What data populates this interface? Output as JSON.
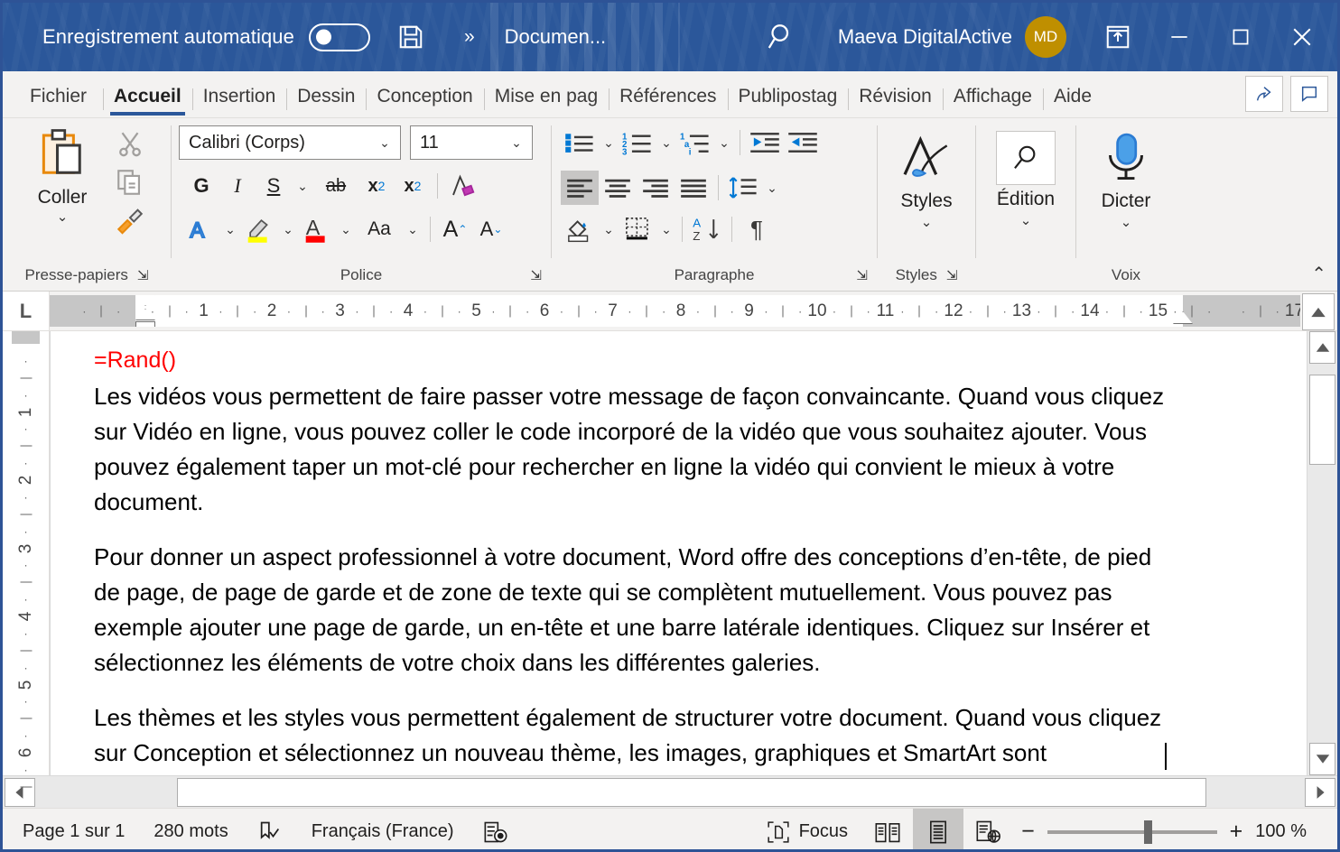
{
  "titlebar": {
    "autosave_label": "Enregistrement automatique",
    "autosave_state": "off",
    "save_icon": "save-icon",
    "more_icon": "chevron-double-right-icon",
    "document_name": "Documen...",
    "search_icon": "search-icon",
    "user_name": "Maeva DigitalActive",
    "avatar_initials": "MD",
    "avatar_color": "#bf8f00",
    "ribbon_display_icon": "ribbon-display-options-icon",
    "minimize_icon": "minimize-icon",
    "maximize_icon": "maximize-icon",
    "close_icon": "close-icon",
    "background_color": "#2b579a"
  },
  "tabs": [
    {
      "label": "Fichier",
      "active": false
    },
    {
      "label": "Accueil",
      "active": true
    },
    {
      "label": "Insertion",
      "active": false
    },
    {
      "label": "Dessin",
      "active": false
    },
    {
      "label": "Conception",
      "active": false
    },
    {
      "label": "Mise en pag",
      "active": false
    },
    {
      "label": "Références",
      "active": false
    },
    {
      "label": "Publipostag",
      "active": false
    },
    {
      "label": "Révision",
      "active": false
    },
    {
      "label": "Affichage",
      "active": false
    },
    {
      "label": "Aide",
      "active": false
    }
  ],
  "tabbar_right": {
    "share_icon": "share-icon",
    "comments_icon": "comment-icon"
  },
  "ribbon": {
    "clipboard": {
      "group_label": "Presse-papiers",
      "paste_label": "Coller",
      "paste_icon": "clipboard-paste-icon",
      "cut_icon": "scissors-icon",
      "copy_icon": "copy-icon",
      "format_painter_icon": "format-painter-icon",
      "launcher_icon": "dialog-launcher-icon"
    },
    "font": {
      "group_label": "Police",
      "family_value": "Calibri (Corps)",
      "size_value": "11",
      "bold_label": "G",
      "italic_label": "I",
      "underline_label": "S",
      "strikethrough_label": "ab",
      "subscript_label": "x",
      "subscript_sub": "2",
      "superscript_label": "x",
      "superscript_sup": "2",
      "clear_format_icon": "clear-formatting-icon",
      "text_effects_icon": "text-effects-icon",
      "highlight_icon": "text-highlight-icon",
      "font_color_icon": "font-color-icon",
      "change_case_label": "Aa",
      "grow_font_label": "A",
      "shrink_font_label": "A",
      "launcher_icon": "dialog-launcher-icon",
      "highlight_color": "#ffff00",
      "font_color": "#ff0000"
    },
    "paragraph": {
      "group_label": "Paragraphe",
      "bullets_icon": "bullet-list-icon",
      "numbering_icon": "numbered-list-icon",
      "multilevel_icon": "multilevel-list-icon",
      "decrease_indent_icon": "decrease-indent-icon",
      "increase_indent_icon": "increase-indent-icon",
      "align_left_icon": "align-left-icon",
      "align_center_icon": "align-center-icon",
      "align_right_icon": "align-right-icon",
      "justify_icon": "justify-icon",
      "line_spacing_icon": "line-spacing-icon",
      "shading_icon": "shading-icon",
      "borders_icon": "borders-icon",
      "sort_icon": "sort-az-icon",
      "show_marks_label": "¶",
      "launcher_icon": "dialog-launcher-icon"
    },
    "styles": {
      "group_label": "Styles",
      "button_label": "Styles",
      "icon": "styles-brush-icon",
      "launcher_icon": "dialog-launcher-icon"
    },
    "editing": {
      "button_label": "Édition",
      "icon": "search-icon"
    },
    "voice": {
      "group_label": "Voix",
      "button_label": "Dicter",
      "icon": "microphone-icon"
    },
    "collapse_icon": "collapse-ribbon-icon"
  },
  "ruler": {
    "tab_stop_label": "L",
    "horizontal_ticks": [
      "1",
      "2",
      "3",
      "4",
      "5",
      "6",
      "7",
      "8",
      "9",
      "10",
      "11",
      "12",
      "13",
      "14",
      "15",
      "17"
    ],
    "vertical_ticks": [
      "1",
      "2",
      "3",
      "4",
      "5",
      "6"
    ]
  },
  "document": {
    "field_code": "=Rand()",
    "field_code_color": "#ff0000",
    "paragraphs": [
      "Les vidéos vous permettent de faire passer votre message de façon convaincante. Quand vous cliquez sur Vidéo en ligne, vous pouvez coller le code incorporé de la vidéo que vous souhaitez ajouter. Vous pouvez également taper un mot-clé pour rechercher en ligne la vidéo qui convient le mieux à votre document.",
      "Pour donner un aspect professionnel à votre document, Word offre des conceptions d’en-tête, de pied de page, de page de garde et de zone de texte qui se complètent mutuellement. Vous pouvez pas exemple ajouter une page de garde, un en-tête et une barre latérale identiques. Cliquez sur Insérer et sélectionnez les éléments de votre choix dans les différentes galeries.",
      "Les thèmes et les styles vous permettent également de structurer votre document. Quand vous cliquez sur Conception et sélectionnez un nouveau thème, les images, graphiques et SmartArt sont"
    ]
  },
  "statusbar": {
    "page_label": "Page 1 sur 1",
    "word_count": "280 mots",
    "proofing_icon": "proofing-icon",
    "language": "Français (France)",
    "accessibility_icon": "accessibility-checker-icon",
    "focus_label": "Focus",
    "focus_icon": "focus-mode-icon",
    "read_mode_icon": "read-mode-icon",
    "print_layout_icon": "print-layout-icon",
    "web_layout_icon": "web-layout-icon",
    "zoom_out_label": "−",
    "zoom_in_label": "+",
    "zoom_value": "100 %"
  }
}
